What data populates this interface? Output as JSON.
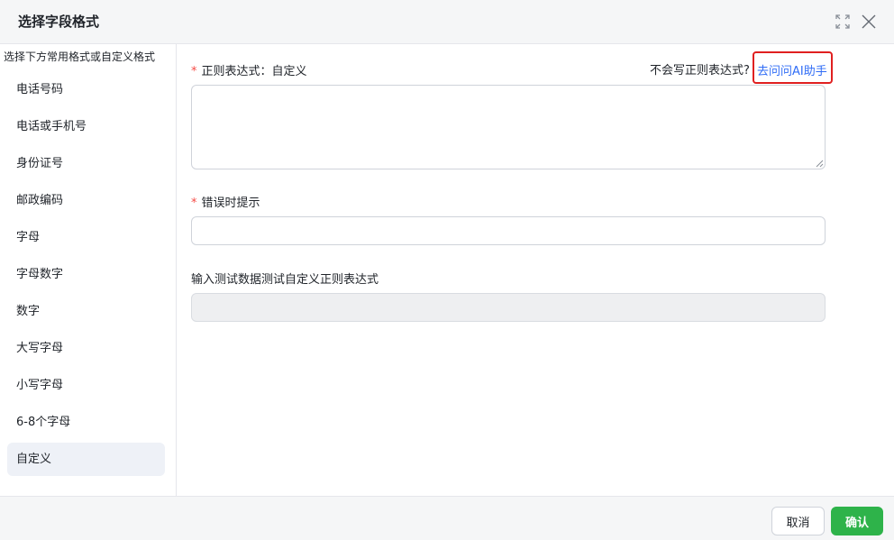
{
  "header": {
    "title": "选择字段格式",
    "expand_icon": "expand-icon",
    "close_icon": "close-icon"
  },
  "sidebar": {
    "hint": "选择下方常用格式或自定义格式",
    "items": [
      {
        "label": "电话号码"
      },
      {
        "label": "电话或手机号"
      },
      {
        "label": "身份证号"
      },
      {
        "label": "邮政编码"
      },
      {
        "label": "字母"
      },
      {
        "label": "字母数字"
      },
      {
        "label": "数字"
      },
      {
        "label": "大写字母"
      },
      {
        "label": "小写字母"
      },
      {
        "label": "6-8个字母"
      },
      {
        "label": "自定义"
      }
    ],
    "active_index": 10
  },
  "main": {
    "regex_label": "正则表达式：自定义",
    "ai_prompt": "不会写正则表达式?",
    "ai_link": "去问问AI助手",
    "regex_value": "",
    "error_label": "错误时提示",
    "error_value": "",
    "test_label": "输入测试数据测试自定义正则表达式",
    "test_value": "",
    "required_mark": "*"
  },
  "footer": {
    "cancel_label": "取消",
    "confirm_label": "确认"
  },
  "colors": {
    "accent_link": "#2f6cf6",
    "confirm_green": "#2eb34a",
    "required_red": "#f54a45",
    "highlight_red": "#e02020"
  }
}
